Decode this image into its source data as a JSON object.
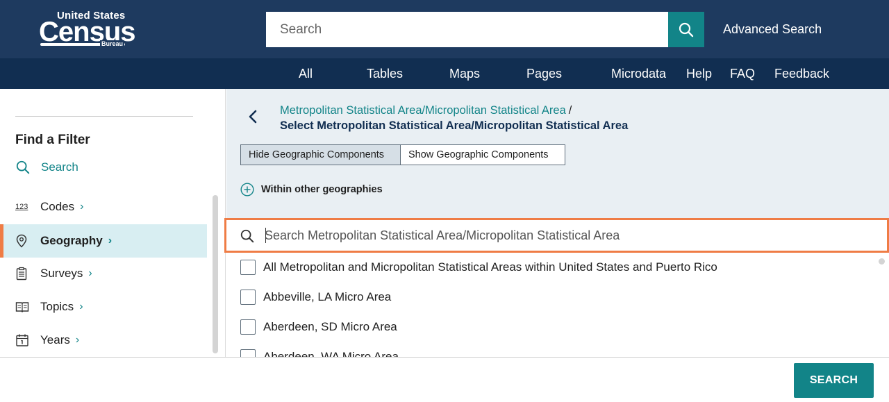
{
  "header": {
    "logo": {
      "line1": "United States",
      "line2": "Census",
      "line3": "Bureau"
    },
    "search_placeholder": "Search",
    "advanced_search": "Advanced Search"
  },
  "nav": {
    "items": [
      "All",
      "Tables",
      "Maps",
      "Pages",
      "Microdata",
      "Help",
      "FAQ",
      "Feedback"
    ]
  },
  "sidebar": {
    "title": "Find a Filter",
    "search_label": "Search",
    "items": [
      {
        "label": "Codes",
        "icon": "codes-123-icon"
      },
      {
        "label": "Geography",
        "icon": "location-pin-icon",
        "active": true
      },
      {
        "label": "Surveys",
        "icon": "clipboard-icon"
      },
      {
        "label": "Topics",
        "icon": "book-icon"
      },
      {
        "label": "Years",
        "icon": "calendar-icon"
      }
    ]
  },
  "main": {
    "breadcrumb_link": "Metropolitan Statistical Area/Micropolitan Statistical Area",
    "breadcrumb_sep": "/",
    "title": "Select Metropolitan Statistical Area/Micropolitan Statistical Area",
    "toggle_hide": "Hide Geographic Components",
    "toggle_show": "Show Geographic Components",
    "within": "Within other geographies",
    "search_placeholder": "Search Metropolitan Statistical Area/Micropolitan Statistical Area",
    "list": [
      "All Metropolitan and Micropolitan Statistical Areas within United States and Puerto Rico",
      "Abbeville, LA Micro Area",
      "Aberdeen, SD Micro Area",
      "Aberdeen, WA Micro Area"
    ]
  },
  "footer": {
    "search_button": "SEARCH"
  },
  "colors": {
    "header_bg": "#1e3a5f",
    "nav_bg": "#112e51",
    "accent_teal": "#128488",
    "highlight_orange": "#ef7c45",
    "active_bg": "#d8eef2"
  }
}
